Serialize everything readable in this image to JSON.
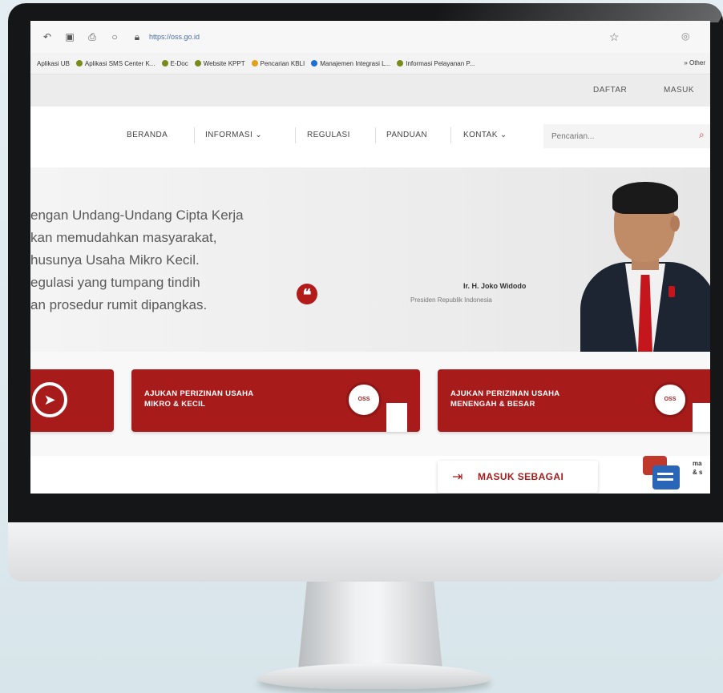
{
  "browser": {
    "url": "https://oss.go.id",
    "bookmarks": [
      "Aplikasi UB",
      "Aplikasi SMS Center K...",
      "E-Doc",
      "Website KPPT",
      "Pencarian KBLI",
      "Manajemen Integrasi L...",
      "Informasi Pelayanan P..."
    ],
    "other_bookmarks": "» Other"
  },
  "site": {
    "top_links": {
      "daftar": "DAFTAR",
      "masuk": "MASUK"
    },
    "nav": {
      "items": [
        "BERANDA",
        "INFORMASI ⌄",
        "REGULASI",
        "PANDUAN",
        "KONTAK ⌄"
      ],
      "search_placeholder": "Pencarian..."
    },
    "hero": {
      "quote_lines": [
        "engan Undang-Undang Cipta Kerja",
        "kan memudahkan masyarakat,",
        "husunya Usaha Mikro Kecil.",
        "egulasi yang tumpang tindih",
        "an prosedur rumit dipangkas."
      ],
      "quote_mark": "❝",
      "speaker_name": "Ir. H. Joko Widodo",
      "speaker_role": "Presiden Republik Indonesia"
    },
    "cards": [
      {
        "label": "",
        "icon": "compass-icon"
      },
      {
        "label_line1": "AJUKAN PERIZINAN USAHA",
        "label_line2": "MIKRO & KECIL",
        "badge": "OSS"
      },
      {
        "label_line1": "AJUKAN PERIZINAN USAHA",
        "label_line2": "MENENGAH & BESAR",
        "badge": "OSS"
      }
    ],
    "masuk_sebagai": "MASUK SEBAGAI",
    "chat_text_line1": "ma",
    "chat_text_line2": "& s"
  },
  "colors": {
    "brand_red": "#a71b1b",
    "monitor_bezel": "#141618"
  }
}
